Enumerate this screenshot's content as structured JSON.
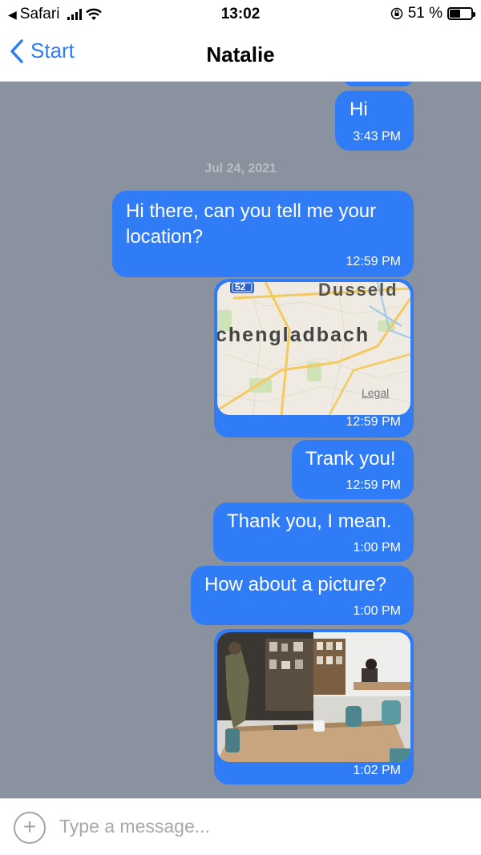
{
  "status_bar": {
    "carrier": "Safari",
    "time": "13:02",
    "battery_text": "51 %",
    "battery_level": 0.51
  },
  "nav": {
    "back_label": "Start",
    "title": "Natalie"
  },
  "chat": {
    "date_separator": "Jul 24, 2021",
    "messages": [
      {
        "text": "Hi",
        "time": "3:43 PM"
      },
      {
        "text": "Hi there, can you tell me your location?",
        "time": "12:59 PM"
      },
      {
        "type": "map",
        "map_city": "chengladbach",
        "map_city2": "Dusseld",
        "map_road": "52",
        "map_legal": "Legal",
        "time": "12:59 PM"
      },
      {
        "text": "Trank you!",
        "time": "12:59 PM"
      },
      {
        "text": "Thank you, I mean.",
        "time": "1:00 PM"
      },
      {
        "text": "How about a picture?",
        "time": "1:00 PM"
      },
      {
        "type": "photo",
        "time": "1:02 PM"
      }
    ]
  },
  "input": {
    "placeholder": "Type a message..."
  },
  "colors": {
    "bubble": "#2f7cf6",
    "chat_background": "#8b929f",
    "accent": "#2f7cf6"
  }
}
